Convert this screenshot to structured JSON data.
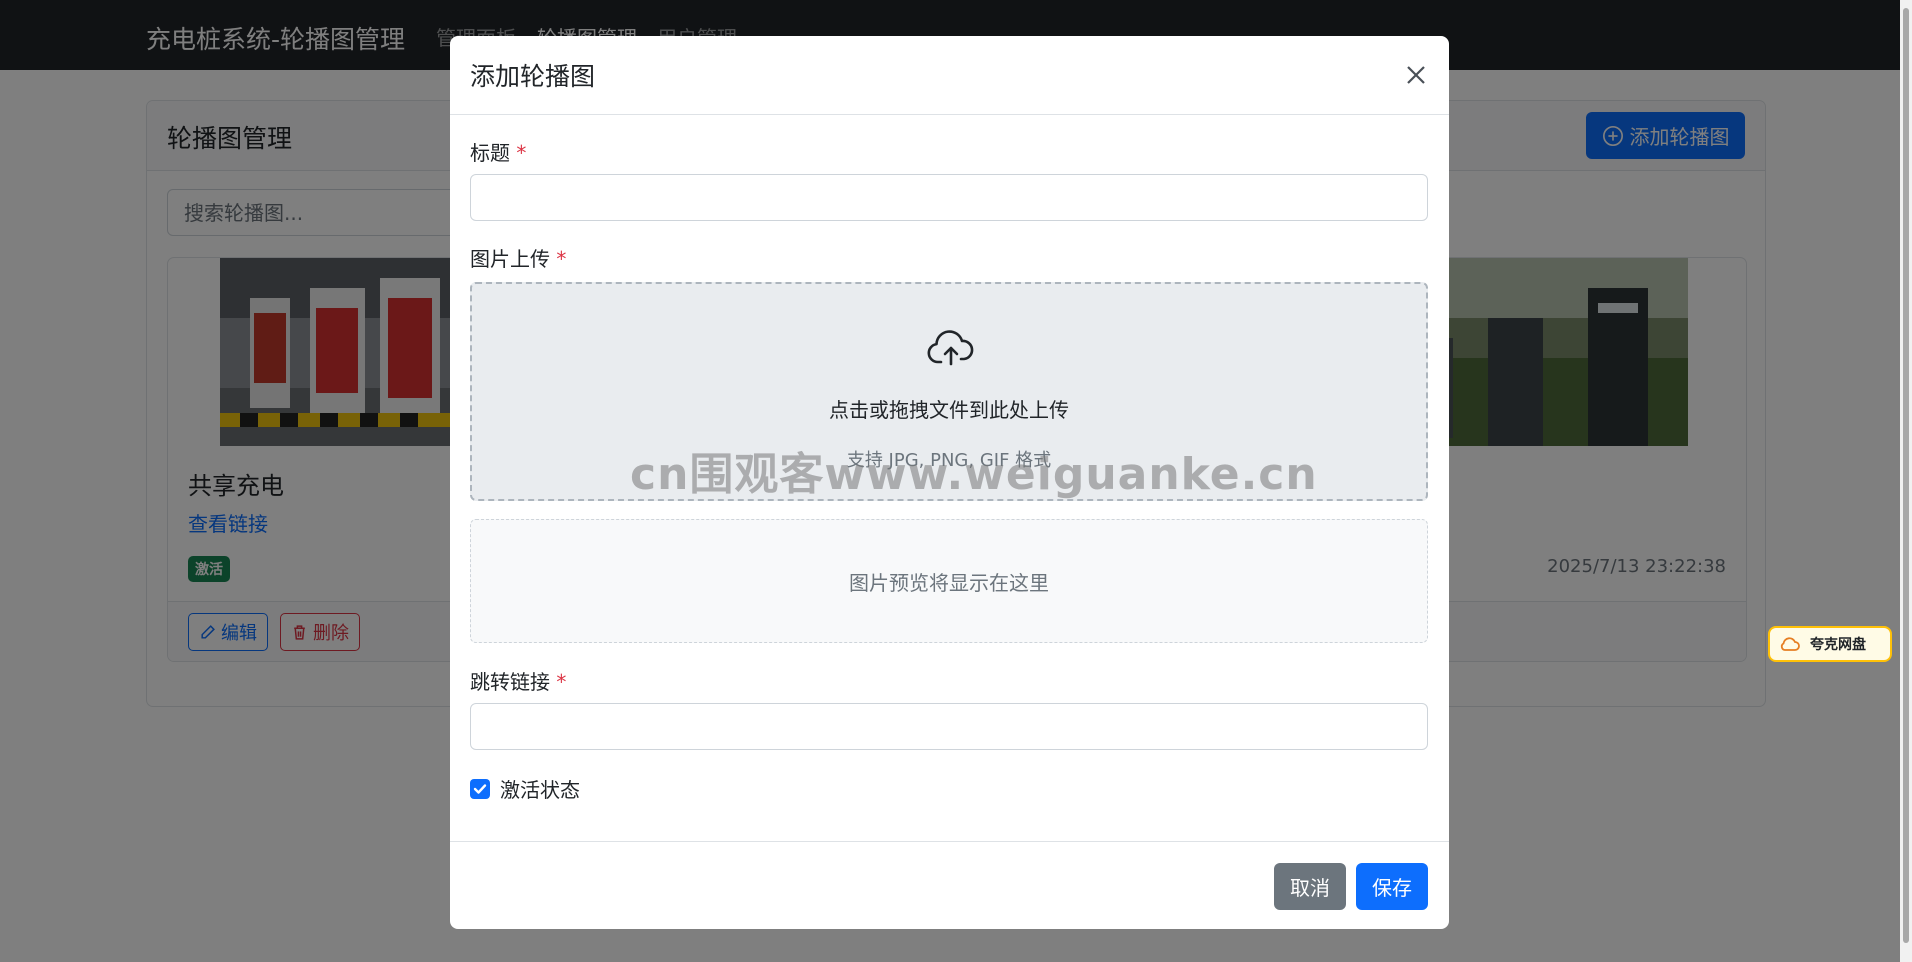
{
  "navbar": {
    "brand": "充电桩系统-轮播图管理",
    "links": [
      "管理面板",
      "轮播图管理",
      "用户管理"
    ]
  },
  "page": {
    "title": "轮播图管理",
    "add_button": "添加轮播图",
    "search_placeholder": "搜索轮播图...",
    "items": [
      {
        "title": "共享充电",
        "link": "查看链接",
        "status": "激活",
        "edit": "编辑",
        "delete": "删除"
      },
      {
        "date": "2025/7/13 23:22:38"
      }
    ]
  },
  "extension": {
    "label": "夸克网盘"
  },
  "modal": {
    "title": "添加轮播图",
    "title_label": "标题",
    "image_label": "图片上传",
    "required_mark": "*",
    "upload_main": "点击或拖拽文件到此处上传",
    "upload_sub": "支持 JPG, PNG, GIF 格式",
    "preview_text": "图片预览将显示在这里",
    "link_label": "跳转链接",
    "active_label": "激活状态",
    "active_checked": true,
    "cancel": "取消",
    "save": "保存"
  },
  "watermark": "cn围观客www.weiguanke.cn",
  "colors": {
    "primary": "#0d6efd",
    "danger": "#dc3545",
    "success": "#198754",
    "secondary": "#6c757d",
    "navbar": "#212529"
  }
}
